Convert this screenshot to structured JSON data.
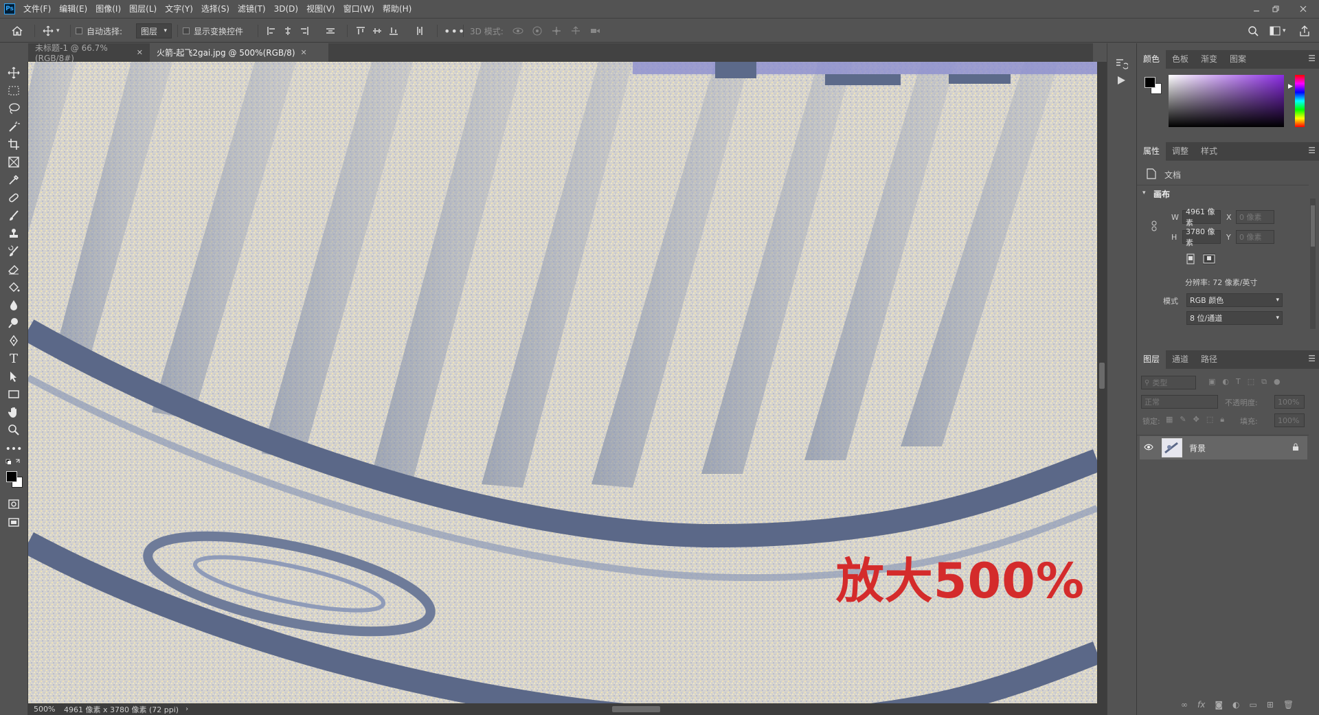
{
  "menubar": {
    "logo": "Ps",
    "items": [
      "文件(F)",
      "编辑(E)",
      "图像(I)",
      "图层(L)",
      "文字(Y)",
      "选择(S)",
      "滤镜(T)",
      "3D(D)",
      "视图(V)",
      "窗口(W)",
      "帮助(H)"
    ]
  },
  "options": {
    "auto_select_label": "自动选择:",
    "auto_select_value": "图层",
    "show_transform_label": "显示变换控件",
    "mode_3d_label": "3D 模式:"
  },
  "tabs": [
    {
      "label": "未标题-1 @ 66.7%(RGB/8#)",
      "active": false
    },
    {
      "label": "火箭-起飞2gai.jpg @ 500%(RGB/8)",
      "active": true
    }
  ],
  "canvas": {
    "overlay_text": "放大500%",
    "overlay_color": "#d42b2b"
  },
  "status": {
    "zoom": "500%",
    "doc_info": "4961 像素 x 3780 像素 (72 ppi)"
  },
  "color_panel": {
    "tabs": [
      "颜色",
      "色板",
      "渐变",
      "图案"
    ],
    "foreground": "#000000",
    "background": "#ffffff",
    "hue_accent": "#8a2be2"
  },
  "properties_panel": {
    "tabs": [
      "属性",
      "调整",
      "样式"
    ],
    "doc_label": "文档",
    "section_canvas": "画布",
    "w_label": "W",
    "w_value": "4961 像素",
    "h_label": "H",
    "h_value": "3780 像素",
    "x_label": "X",
    "x_value": "0 像素",
    "y_label": "Y",
    "y_value": "0 像素",
    "resolution": "分辨率: 72 像素/英寸",
    "mode_label": "模式",
    "mode_value": "RGB 颜色",
    "depth_value": "8 位/通道"
  },
  "layers_panel": {
    "tabs": [
      "图层",
      "通道",
      "路径"
    ],
    "filter_placeholder": "类型",
    "blend_mode": "正常",
    "opacity_label": "不透明度:",
    "opacity_value": "100%",
    "lock_label": "锁定:",
    "fill_label": "填充:",
    "fill_value": "100%",
    "layers": [
      {
        "name": "背景",
        "visible": true,
        "locked": true
      }
    ]
  }
}
